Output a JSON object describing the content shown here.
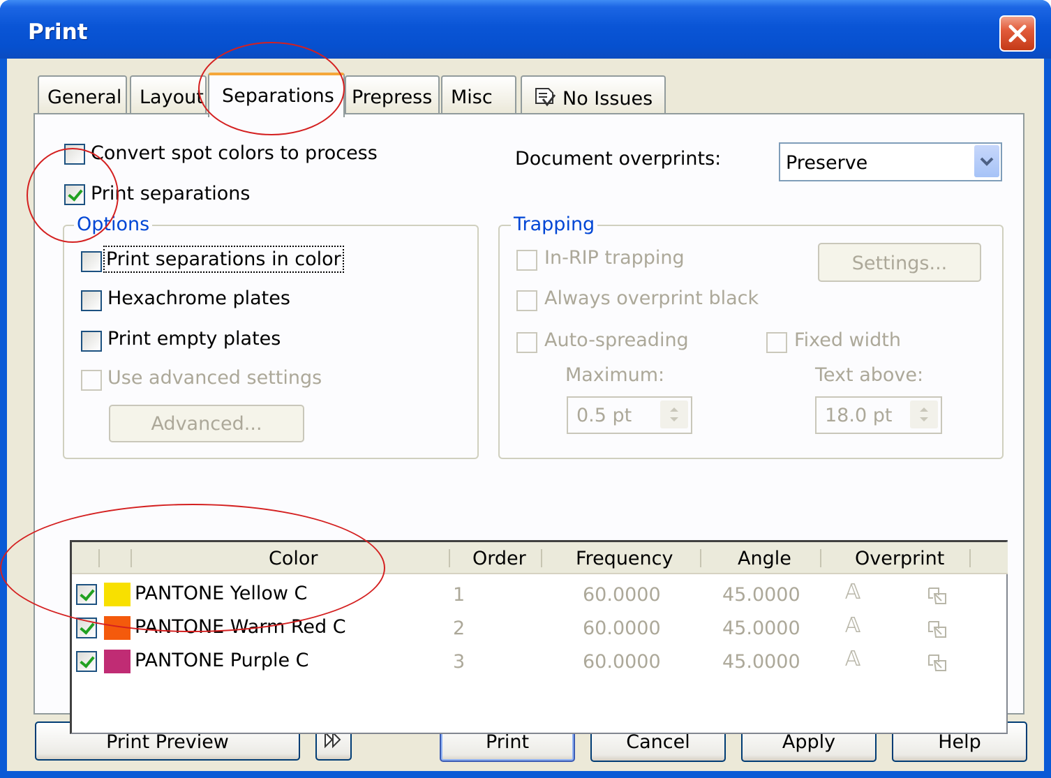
{
  "window": {
    "title": "Print"
  },
  "tabs": [
    {
      "label": "General"
    },
    {
      "label": "Layout"
    },
    {
      "label": "Separations"
    },
    {
      "label": "Prepress"
    },
    {
      "label": "Misc"
    },
    {
      "label": "No Issues",
      "icon": "issues-icon"
    }
  ],
  "separations": {
    "convert_spot": {
      "label": "Convert spot colors to process",
      "checked": false
    },
    "print_separations": {
      "label": "Print separations",
      "checked": true
    },
    "document_overprints": {
      "label": "Document overprints:",
      "value": "Preserve"
    },
    "options": {
      "legend": "Options",
      "print_in_color": {
        "label": "Print separations in color",
        "checked": false
      },
      "hexachrome": {
        "label": "Hexachrome plates",
        "checked": false
      },
      "empty_plates": {
        "label": "Print empty plates",
        "checked": false
      },
      "advanced_settings": {
        "label": "Use advanced settings",
        "checked": false,
        "enabled": false
      },
      "advanced_button": "Advanced..."
    },
    "trapping": {
      "legend": "Trapping",
      "in_rip": "In-RIP trapping",
      "settings_button": "Settings...",
      "overprint_black": "Always overprint black",
      "auto_spreading": "Auto-spreading",
      "fixed_width": "Fixed width",
      "maximum_label": "Maximum:",
      "maximum_value": "0.5 pt",
      "text_above_label": "Text above:",
      "text_above_value": "18.0 pt"
    },
    "table": {
      "headers": {
        "color": "Color",
        "order": "Order",
        "frequency": "Frequency",
        "angle": "Angle",
        "overprint": "Overprint"
      },
      "rows": [
        {
          "checked": true,
          "swatch": "#f8e000",
          "name": "PANTONE Yellow C",
          "order": "1",
          "frequency": "60.0000",
          "angle": "45.0000"
        },
        {
          "checked": true,
          "swatch": "#f45a0c",
          "name": "PANTONE Warm Red C",
          "order": "2",
          "frequency": "60.0000",
          "angle": "45.0000"
        },
        {
          "checked": true,
          "swatch": "#c02c74",
          "name": "PANTONE Purple C",
          "order": "3",
          "frequency": "60.0000",
          "angle": "45.0000"
        }
      ]
    }
  },
  "footer": {
    "print_preview": "Print Preview",
    "print": "Print",
    "cancel": "Cancel",
    "apply": "Apply",
    "help": "Help"
  },
  "colors": {
    "titlebar": "#0a55d6",
    "dialog_bg": "#ece9d8",
    "annotation_ring": "#d42020"
  }
}
